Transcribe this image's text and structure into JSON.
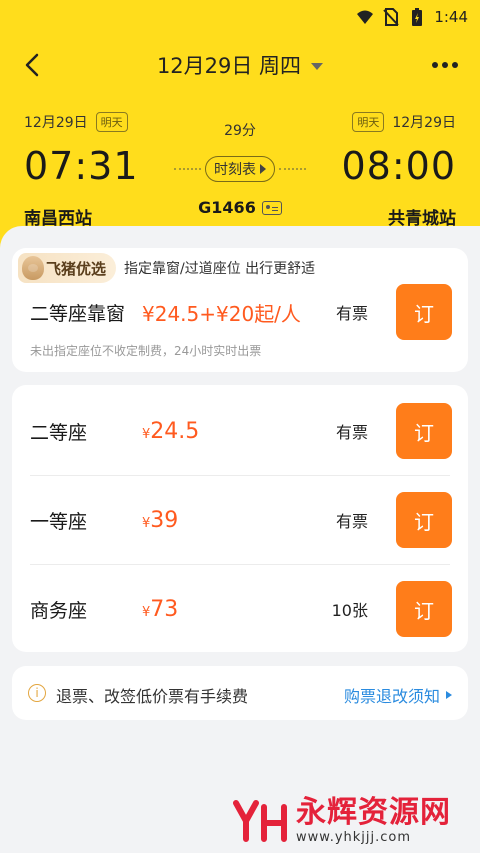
{
  "status_bar": {
    "time": "1:44"
  },
  "nav": {
    "title": "12月29日 周四"
  },
  "trip": {
    "dep_date": "12月29日",
    "dep_tag": "明天",
    "arr_date": "12月29日",
    "arr_tag": "明天",
    "duration": "29分",
    "dep_time": "07:31",
    "arr_time": "08:00",
    "timetable_label": "时刻表",
    "dep_station": "南昌西站",
    "arr_station": "共青城站",
    "train_no": "G1466"
  },
  "premium": {
    "brand": "飞猪优选",
    "desc": "指定靠窗/过道座位 出行更舒适",
    "seat_name": "二等座靠窗",
    "price": "¥24.5+¥20起/人",
    "availability": "有票",
    "note": "未出指定座位不收定制费，24小时实时出票",
    "book_label": "订"
  },
  "seats": [
    {
      "name": "二等座",
      "yen": "¥",
      "price": "24.5",
      "availability": "有票",
      "book_label": "订"
    },
    {
      "name": "一等座",
      "yen": "¥",
      "price": "39",
      "availability": "有票",
      "book_label": "订"
    },
    {
      "name": "商务座",
      "yen": "¥",
      "price": "73",
      "availability": "10张",
      "book_label": "订"
    }
  ],
  "notice": {
    "text": "退票、改签低价票有手续费",
    "link": "购票退改须知"
  },
  "watermark": {
    "title": "永辉资源网",
    "url": "www.yhkjjj.com"
  },
  "colors": {
    "header_bg": "#ffdd1c",
    "accent_orange": "#ff7d1a",
    "price_orange": "#ff5a1f",
    "link_blue": "#2a8bdf"
  }
}
